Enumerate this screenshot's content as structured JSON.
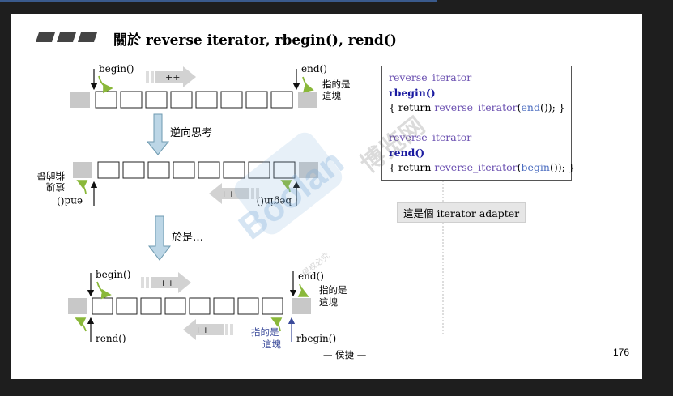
{
  "title": "關於 reverse iterator, rbegin(), rend()",
  "row1": {
    "begin": "begin()",
    "end": "end()",
    "points_to_1": "指的是",
    "points_to_2": "這塊",
    "plus": "++"
  },
  "step1": {
    "label": "逆向思考"
  },
  "row2": {
    "begin_flipped": "begin()",
    "end_flipped": "end()",
    "points_to_1": "指的是",
    "points_to_2": "這塊",
    "plus": "++"
  },
  "step2": {
    "label": "於是…"
  },
  "row3": {
    "begin": "begin()",
    "end": "end()",
    "points_to_1": "指的是",
    "points_to_2": "這塊",
    "plus": "++",
    "rend": "rend()",
    "rbegin": "rbegin()",
    "points_to_3": "指的是",
    "points_to_4": "這塊"
  },
  "code": {
    "block1": {
      "line1": "reverse_iterator",
      "line2": "rbegin()",
      "line3_prefix": "{ return ",
      "line3_type": "reverse_iterator",
      "line3_open": "(",
      "line3_call": "end",
      "line3_close": "()); }"
    },
    "block2": {
      "line1": "reverse_iterator",
      "line2": "rend()",
      "line3_prefix": "{ return ",
      "line3_type": "reverse_iterator",
      "line3_open": "(",
      "line3_call": "begin",
      "line3_close": "()); }"
    }
  },
  "adapter_note": "這是個 iterator adapter",
  "footer_author": "— 侯捷 —",
  "page_number": "176",
  "watermark": {
    "brand": "Boolan",
    "cjk": "博览网",
    "small": "侵权必究"
  },
  "colors": {
    "cell_gray": "#c8c8c8",
    "arrow_green": "#8ab83a",
    "arrow_blue_fill": "#bcd6e6",
    "arrow_blue_stroke": "#6e9ab0",
    "wm_blue": "#78aad7"
  }
}
